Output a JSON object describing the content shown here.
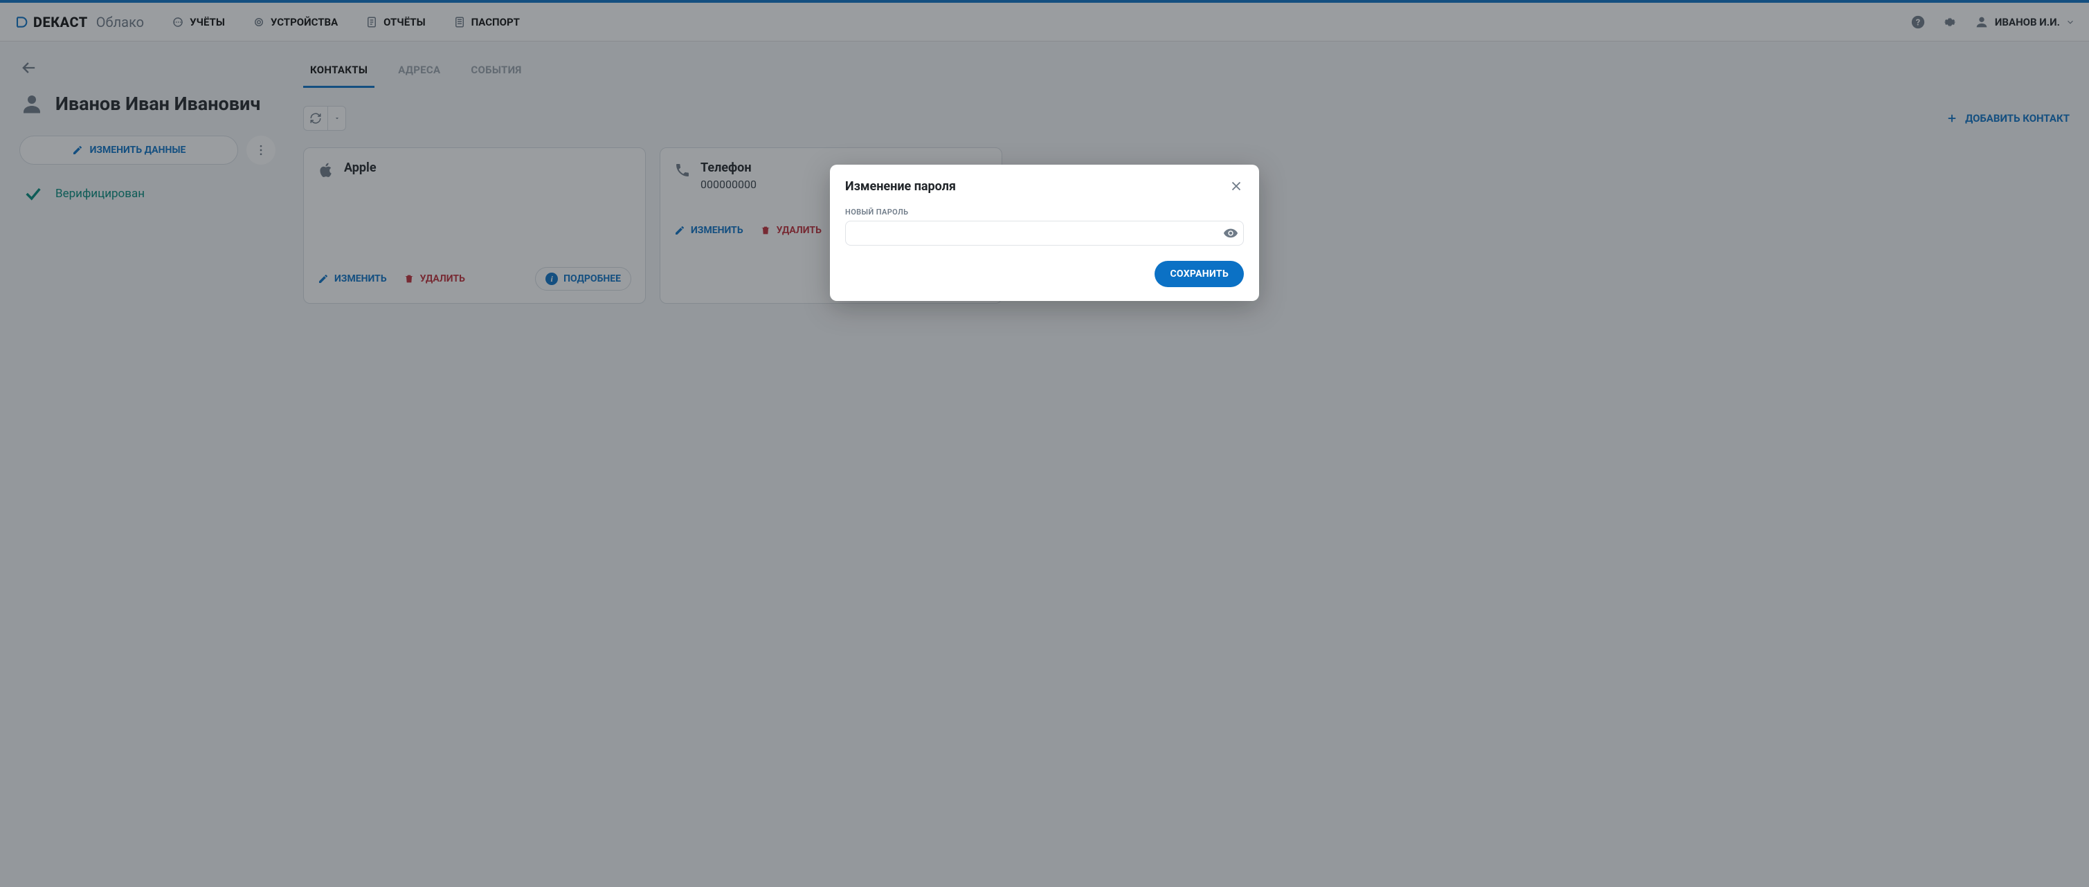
{
  "brand": {
    "name": "DЕКАСТ",
    "sub": "Облако"
  },
  "nav": {
    "accounts": "УЧЁТЫ",
    "devices": "УСТРОЙСТВА",
    "reports": "ОТЧЁТЫ",
    "passport": "ПАСПОРТ"
  },
  "user_menu": {
    "name": "ИВАНОВ И.И."
  },
  "profile": {
    "name": "Иванов Иван Иванович",
    "edit_label": "ИЗМЕНИТЬ ДАННЫЕ",
    "verified_label": "Верифицирован"
  },
  "tabs": {
    "contacts": "КОНТАКТЫ",
    "addresses": "АДРЕСА",
    "events": "СОБЫТИЯ"
  },
  "add_contact_label": "ДОБАВИТЬ КОНТАКТ",
  "card_actions": {
    "edit": "ИЗМЕНИТЬ",
    "delete": "УДАЛИТЬ",
    "info": "ПОДРОБНЕЕ"
  },
  "contacts": [
    {
      "title": "Apple",
      "value": "",
      "tag": ""
    },
    {
      "title": "Телефон",
      "value": "000000000",
      "tag": ""
    }
  ],
  "modal": {
    "title": "Изменение пароля",
    "field_label": "НОВЫЙ ПАРОЛЬ",
    "field_value": "",
    "save_label": "СОХРАНИТЬ"
  },
  "colors": {
    "accent": "#0b71c5",
    "danger": "#bf2e3a",
    "success": "#00897b"
  }
}
